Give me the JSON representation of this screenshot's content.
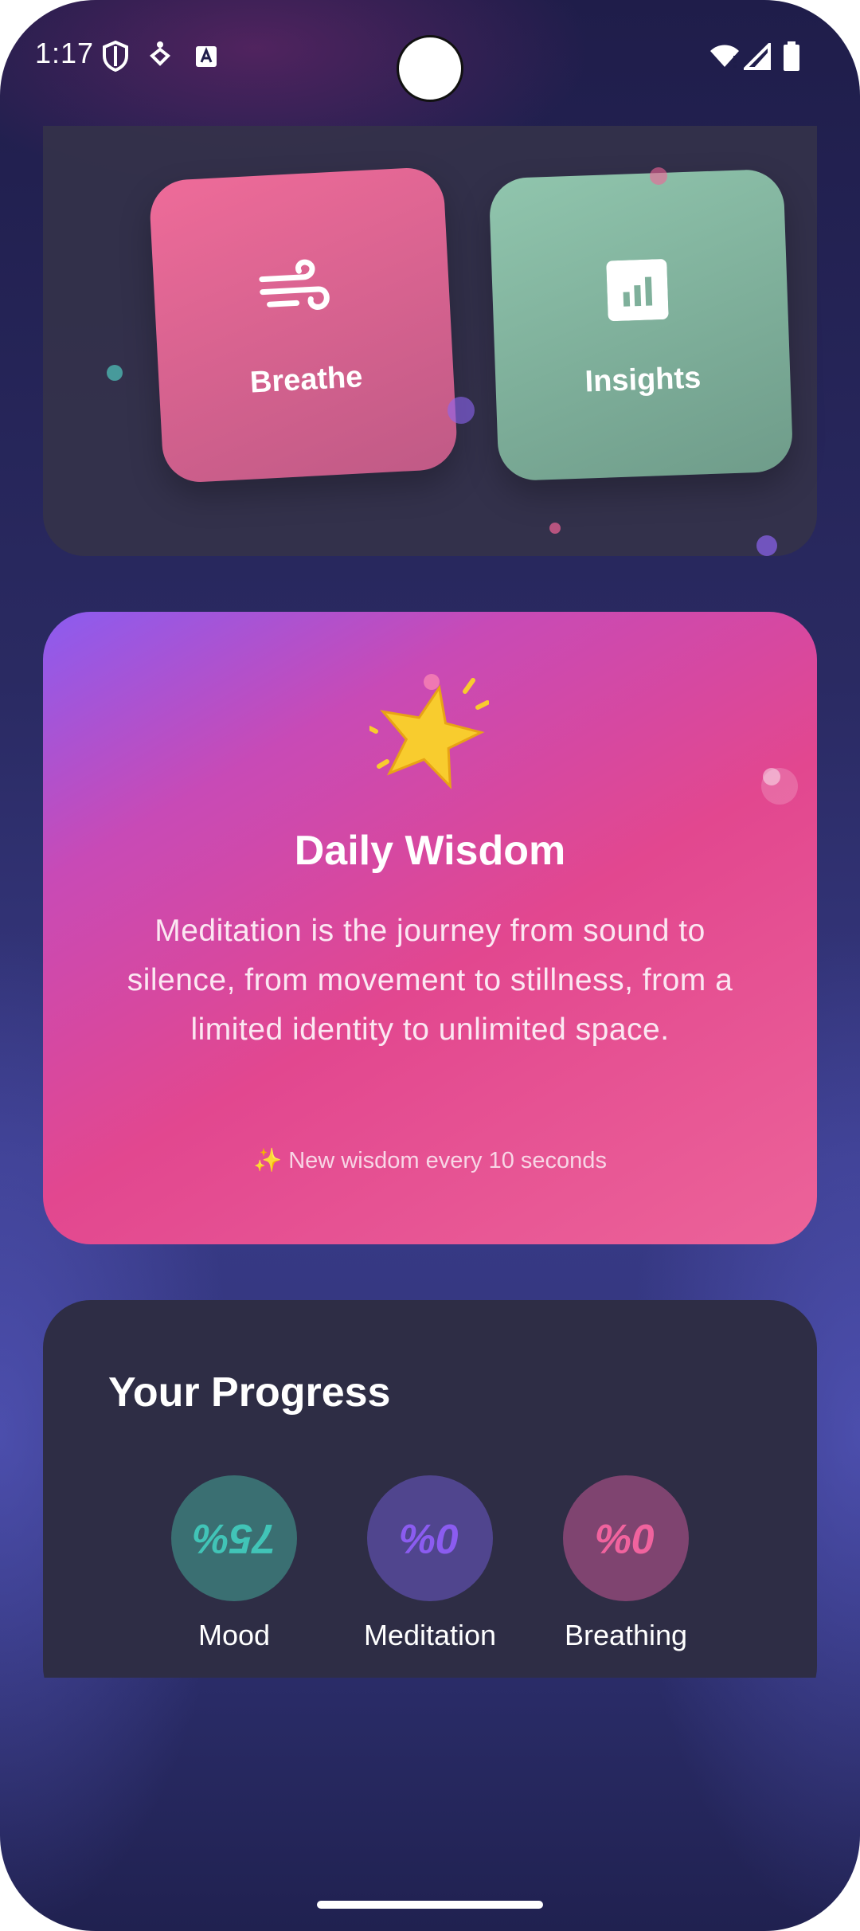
{
  "status_bar": {
    "time": "1:17"
  },
  "tiles": [
    {
      "label": "Breathe",
      "icon": "wind-icon",
      "color": "#ee6b99"
    },
    {
      "label": "Insights",
      "icon": "bar-chart-icon",
      "color": "#90c5ad"
    }
  ],
  "wisdom": {
    "emoji": "star-icon",
    "title": "Daily Wisdom",
    "quote": "Meditation is the journey from sound to silence, from movement to stillness, from a limited identity to unlimited space.",
    "note": "✨ New wisdom every 10 seconds"
  },
  "progress": {
    "title": "Your Progress",
    "stats": [
      {
        "label": "Mood",
        "value": "75%",
        "color": "#41c4b7",
        "bg": "#3a6f72"
      },
      {
        "label": "Meditation",
        "value": "0%",
        "color": "#8b5cf0",
        "bg": "#50458e"
      },
      {
        "label": "Breathing",
        "value": "0%",
        "color": "#f0639e",
        "bg": "#7f4470"
      }
    ]
  }
}
